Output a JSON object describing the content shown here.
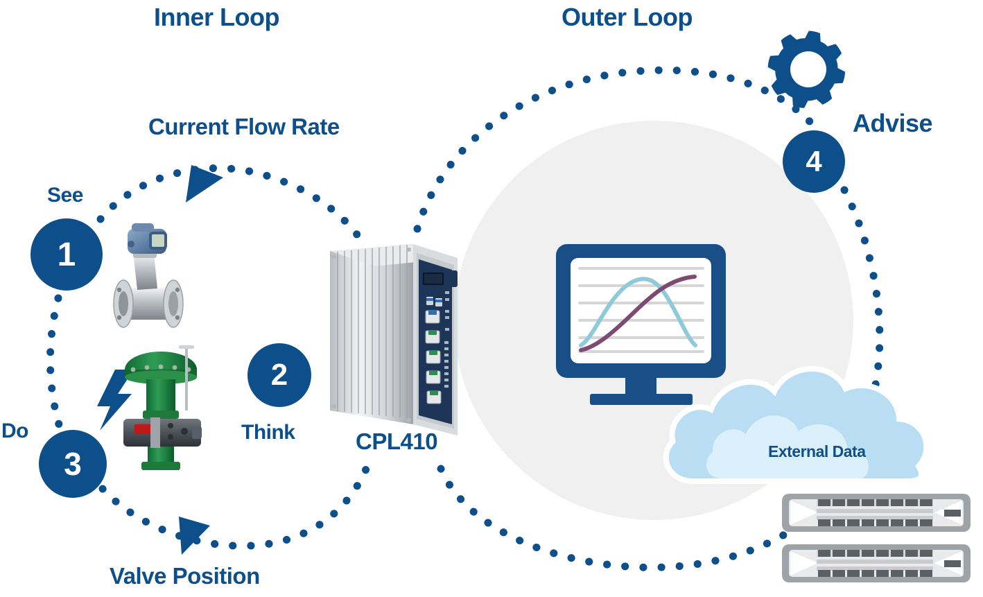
{
  "diagram": {
    "title_inner": "Inner Loop",
    "title_outer": "Outer Loop",
    "accent_blue": "#0d4f8b",
    "gray_circle": "#f0f0f0",
    "cloud_light": "#b9ddf3",
    "cloud_pale": "#d9edf9",
    "chart_line_teal": "#8ecada",
    "chart_line_purple": "#7c4a72"
  },
  "labels": {
    "inner_loop": "Inner Loop",
    "outer_loop": "Outer Loop",
    "current_flow_rate": "Current Flow Rate",
    "valve_position": "Valve Position",
    "see": "See",
    "think": "Think",
    "do": "Do",
    "advise": "Advise",
    "cpl410": "CPL410",
    "external_data": "External Data"
  },
  "steps": [
    {
      "number": "1",
      "label": "See"
    },
    {
      "number": "2",
      "label": "Think"
    },
    {
      "number": "3",
      "label": "Do"
    },
    {
      "number": "4",
      "label": "Advise"
    }
  ],
  "icons": {
    "gear": "gear-icon",
    "monitor": "monitor-icon",
    "cloud": "cloud-icon",
    "server": "server-rack-icon",
    "lightning": "lightning-bolt-icon",
    "flow_meter": "flow-meter-photo",
    "control_valve": "control-valve-photo",
    "controller": "cpl410-controller-photo"
  },
  "chart_data": {
    "type": "line",
    "title": "",
    "xlabel": "",
    "ylabel": "",
    "grid": true,
    "legend": "none",
    "x": [
      0,
      1,
      2,
      3,
      4,
      5,
      6,
      7,
      8,
      9,
      10
    ],
    "series": [
      {
        "name": "teal-curve",
        "color": "#8ecada",
        "values": [
          0,
          22,
          50,
          74,
          88,
          92,
          86,
          72,
          52,
          28,
          8
        ]
      },
      {
        "name": "purple-curve",
        "color": "#7c4a72",
        "values": [
          8,
          16,
          28,
          44,
          60,
          76,
          87,
          94,
          98,
          100,
          100
        ]
      }
    ],
    "ylim": [
      0,
      110
    ],
    "gridline_count": 7
  }
}
